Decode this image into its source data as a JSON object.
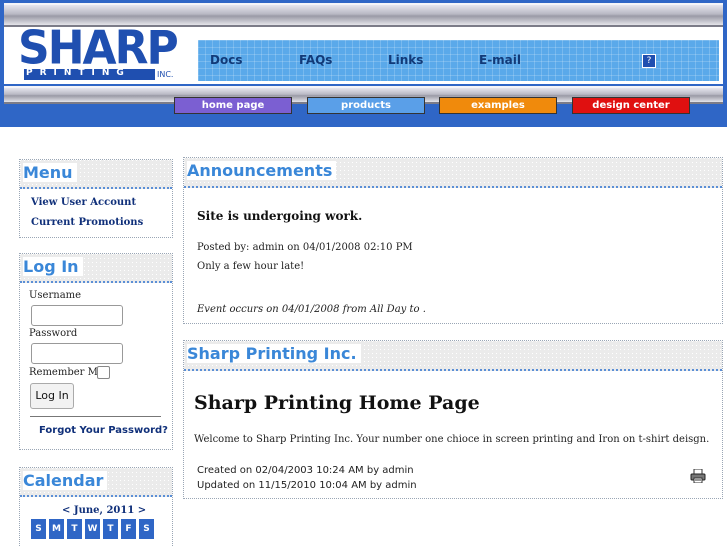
{
  "header": {
    "logo": {
      "brand": "SHARP",
      "sub": "PRINTING",
      "suffix": "INC."
    },
    "nav": [
      {
        "label": "Docs"
      },
      {
        "label": "FAQs"
      },
      {
        "label": "Links"
      },
      {
        "label": "E-mail"
      }
    ],
    "help_icon": "?",
    "tabs": [
      {
        "label": "home page",
        "color": "#7b5fd2"
      },
      {
        "label": "products",
        "color": "#5a9fe8"
      },
      {
        "label": "examples",
        "color": "#f08a0c"
      },
      {
        "label": "design center",
        "color": "#e01010"
      }
    ]
  },
  "sidebar": {
    "menu": {
      "title": "Menu",
      "items": [
        {
          "label": "View User Account"
        },
        {
          "label": "Current Promotions"
        }
      ]
    },
    "login": {
      "title": "Log In",
      "username_label": "Username",
      "username_value": "",
      "password_label": "Password",
      "password_value": "",
      "remember_label": "Remember Me",
      "submit_label": "Log In",
      "forgot_label": "Forgot Your Password?"
    },
    "calendar": {
      "title": "Calendar",
      "month_label": "< June, 2011 >",
      "days": [
        "S",
        "M",
        "T",
        "W",
        "T",
        "F",
        "S"
      ]
    }
  },
  "main": {
    "announcements": {
      "title": "Announcements",
      "headline": "Site is undergoing work.",
      "posted": "Posted by: admin on 04/01/2008 02:10 PM",
      "body": "Only a few hour late!",
      "event": "Event occurs on 04/01/2008 from All Day to ."
    },
    "article": {
      "title": "Sharp Printing Inc.",
      "heading": "Sharp Printing Home Page",
      "body": "Welcome to Sharp Printing Inc. Your number one chioce in screen printing and Iron on t-shirt deisgn.",
      "created": "Created on 02/04/2003 10:24 AM by admin",
      "updated": "Updated on 11/15/2010 10:04 AM by admin",
      "print_icon": "print-icon"
    }
  }
}
